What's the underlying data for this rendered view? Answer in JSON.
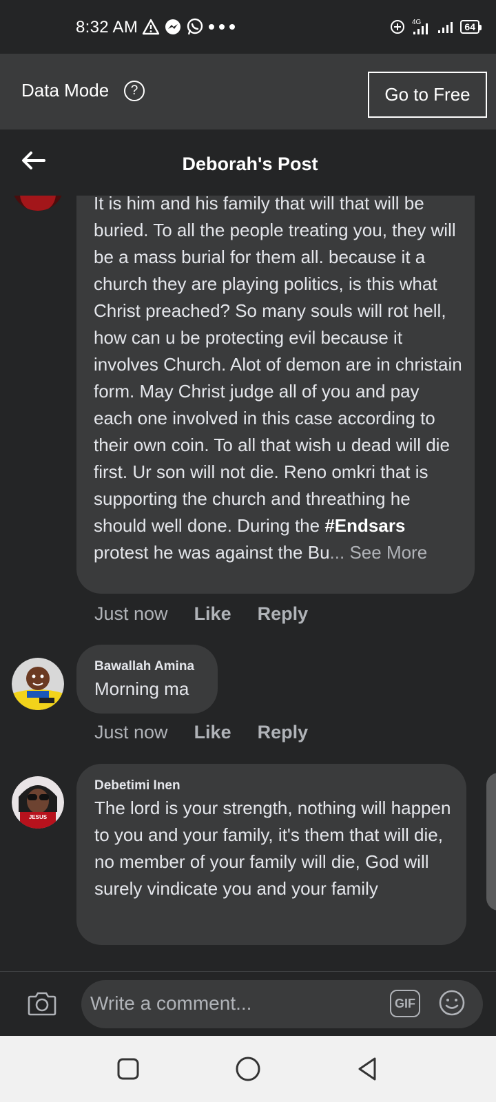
{
  "status_bar": {
    "time": "8:32 AM",
    "battery": "64",
    "network": "4G"
  },
  "data_banner": {
    "label": "Data Mode",
    "help_glyph": "?",
    "button_label": "Go to Free"
  },
  "header": {
    "title": "Deborah's Post"
  },
  "comments": [
    {
      "author": "",
      "text_before": "It is him and his family that will that will be buried. To all the people treating you, they will be a mass burial for them all. because it a church they are playing politics, is this what Christ preached? So many souls will rot hell, how can u be protecting evil because it involves Church. Alot of demon are in christain form. May Christ judge all of you and pay each one involved in this case according to their own coin. To all that wish u dead will die first. Ur son will not die. Reno omkri that is supporting the church and threathing he should well done. During the ",
      "hashtag": "#Endsars",
      "text_after": " protest he was against the Bu",
      "ellipsis": "... ",
      "see_more": "See More",
      "time": "Just now",
      "like": "Like",
      "reply": "Reply"
    },
    {
      "author": "Bawallah Amina",
      "text": "Morning ma",
      "time": "Just now",
      "like": "Like",
      "reply": "Reply"
    },
    {
      "author": "Debetimi Inen",
      "text": "The lord is your strength,  nothing will happen to you and your family,  it's them that will die,  no member of your family will die,  God will surely vindicate you and your family",
      "avatar_caption": "JESUS"
    }
  ],
  "composer": {
    "placeholder": "Write a comment...",
    "gif_label": "GIF"
  },
  "icons": {
    "back": "back-arrow-icon",
    "camera": "camera-icon",
    "emoji": "emoji-icon",
    "help": "help-icon"
  }
}
